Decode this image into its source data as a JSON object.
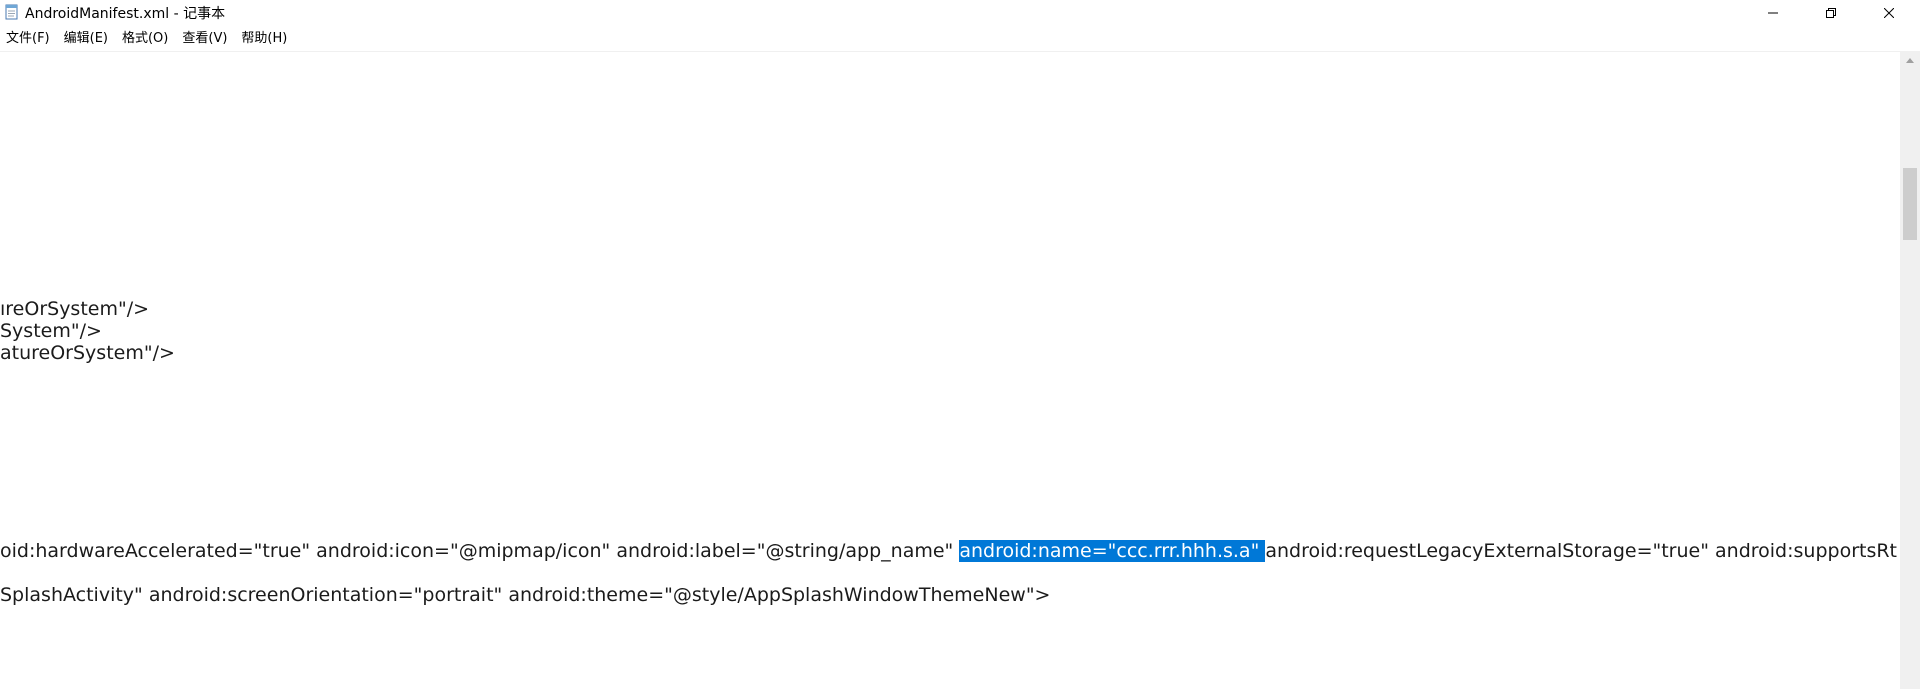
{
  "window": {
    "title": "AndroidManifest.xml - 记事本",
    "icon": "notepad-icon",
    "minimize_icon": "minimize-icon",
    "maximize_icon": "restore-icon",
    "close_icon": "close-icon"
  },
  "menu": {
    "items": [
      {
        "label": "文件(F)"
      },
      {
        "label": "编辑(E)"
      },
      {
        "label": "格式(O)"
      },
      {
        "label": "查看(V)"
      },
      {
        "label": "帮助(H)"
      }
    ]
  },
  "editor": {
    "lines": [
      {
        "text": "ıreOrSystem\"/>"
      },
      {
        "text": "System\"/>"
      },
      {
        "text": "atureOrSystem\"/>"
      },
      {
        "before": "oid:hardwareAccelerated=\"true\" android:icon=\"@mipmap/icon\" android:label=\"@string/app_name\" ",
        "selected": "android:name=\"ccc.rrr.hhh.s.a\" ",
        "after": "android:requestLegacyExternalStorage=\"true\" android:supportsRt"
      },
      {
        "text": "SplashActivity\" android:screenOrientation=\"portrait\" android:theme=\"@style/AppSplashWindowThemeNew\">"
      }
    ],
    "selection_color": "#0078d7"
  },
  "scrollbar": {
    "position_fraction": 0.2
  }
}
